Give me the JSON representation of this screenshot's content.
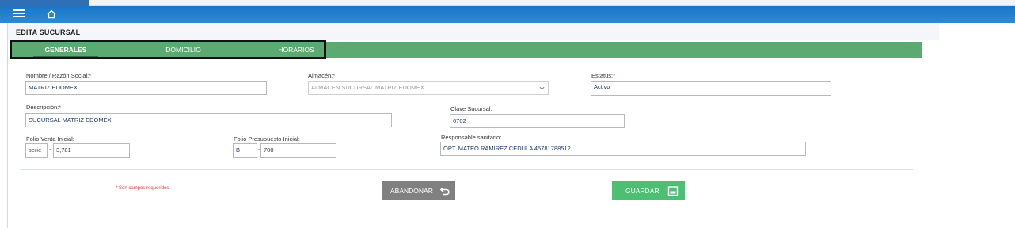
{
  "navbar": {
    "menu_icon": "menu-icon",
    "home_icon": "home-icon"
  },
  "page": {
    "title": "EDITA SUCURSAL"
  },
  "tabs": [
    {
      "label": "GENERALES",
      "active": true
    },
    {
      "label": "DOMICILIO",
      "active": false
    },
    {
      "label": "HORARIOS",
      "active": false
    }
  ],
  "form": {
    "required_mark": "*",
    "nombre": {
      "label": "Nombre / Razón Social:",
      "value": "MATRIZ EDOMEX"
    },
    "almacen": {
      "label": "Almacén:",
      "value": "ALMACEN SUCURSAL MATRIZ EDOMEX"
    },
    "estatus": {
      "label": "Estatus:",
      "value": "Activo"
    },
    "descripcion": {
      "label": "Descripción:",
      "value": "SUCURSAL MATRIZ EDOMEX"
    },
    "clave": {
      "label": "Clave Sucursal:",
      "value": "6702"
    },
    "folio_venta": {
      "label": "Folio Venta Inicial:",
      "prefix": "serie",
      "separator": "-",
      "value": "3,781"
    },
    "folio_presupuesto": {
      "label": "Folio Presupuesto Inicial:",
      "prefix": "B",
      "separator": "-",
      "value": "700"
    },
    "responsable": {
      "label": "Responsable sanitario:",
      "value": "OPT. MATEO RAMIREZ CEDULA 45781788512"
    },
    "required_note": "* Son campos requeridos"
  },
  "buttons": {
    "abandon": {
      "label": "ABANDONAR",
      "icon": "undo-icon"
    },
    "save": {
      "label": "GUARDAR",
      "icon": "save-icon"
    }
  },
  "colors": {
    "navbar": "#1a74c6",
    "tabbar": "#5aaa72",
    "save": "#4cbf72",
    "abandon": "#808080",
    "required": "#e53935"
  }
}
